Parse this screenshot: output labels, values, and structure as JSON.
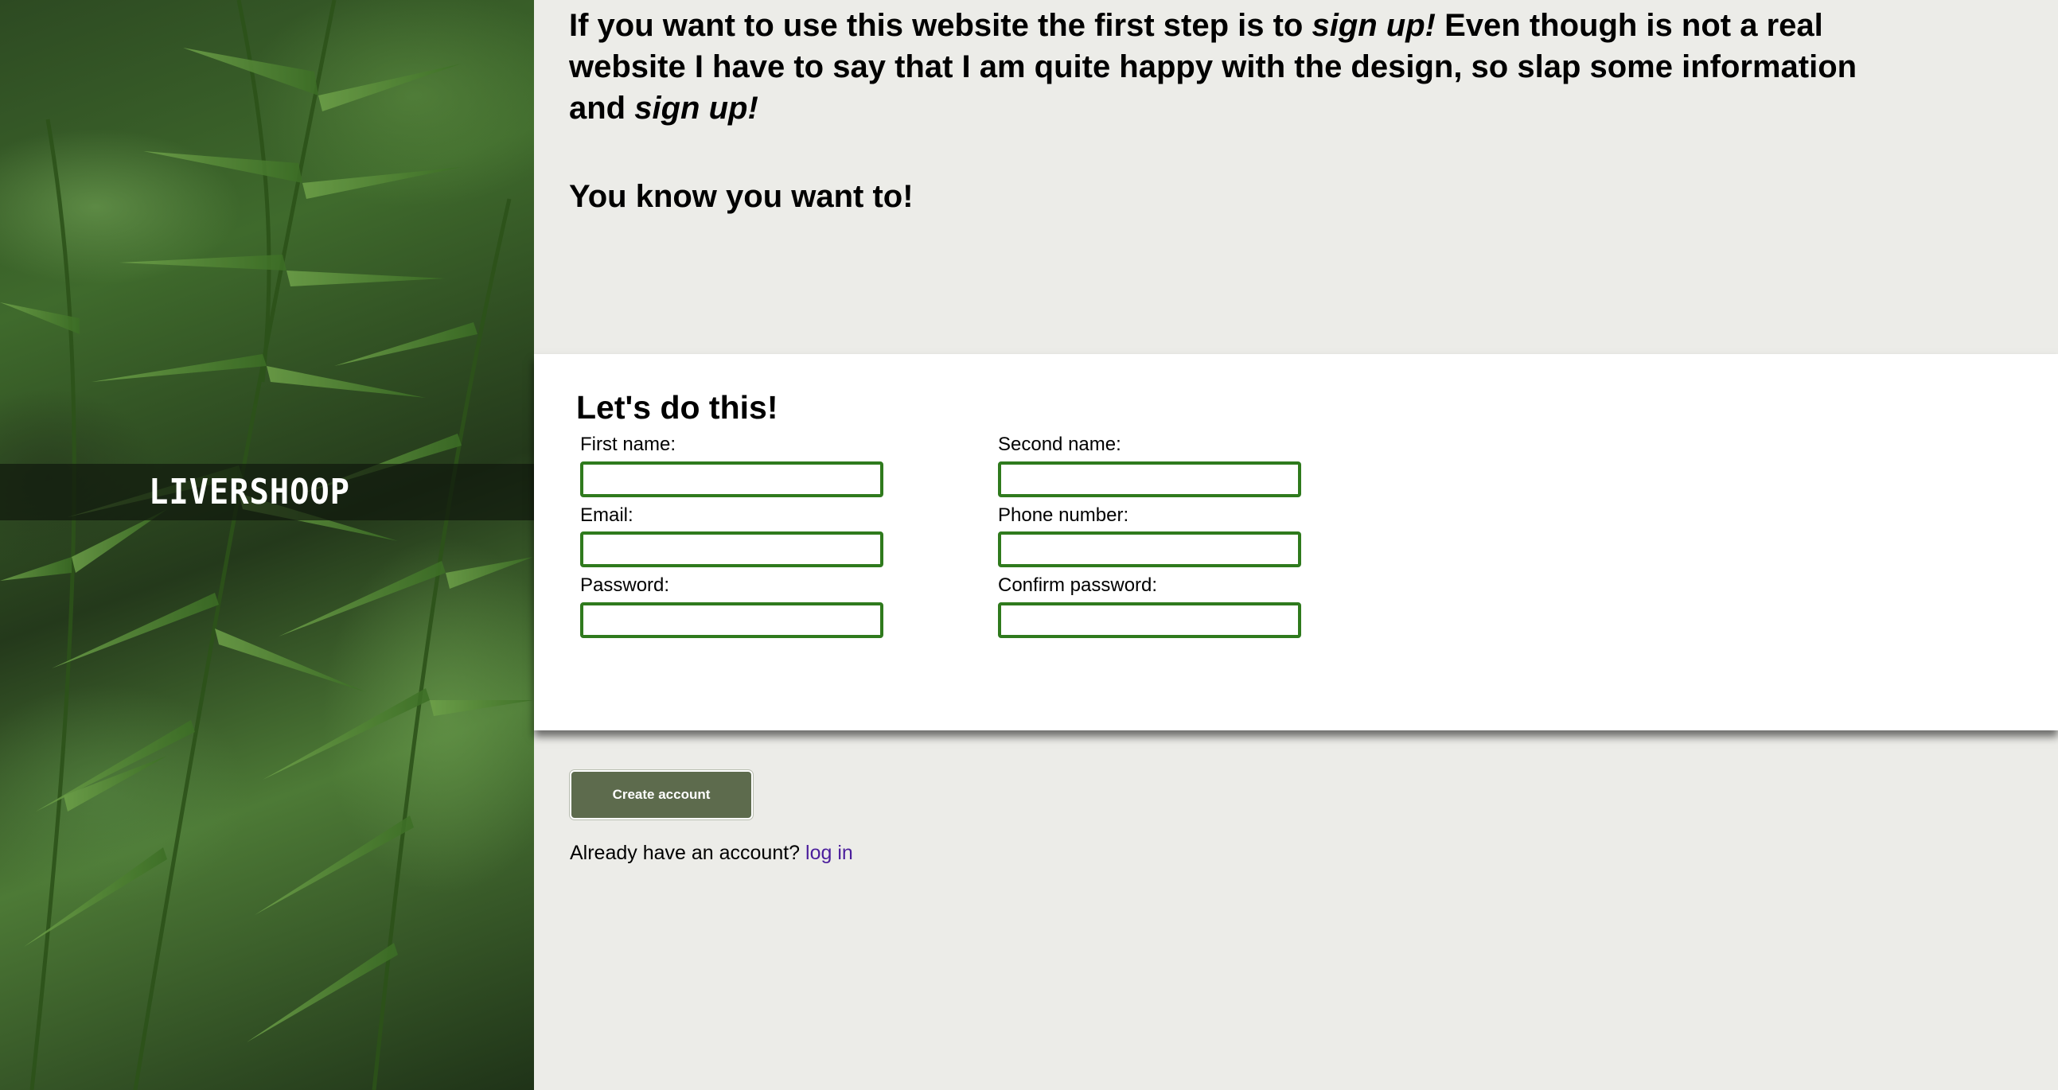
{
  "brand": {
    "name": "LIVERSHOOP"
  },
  "intro": {
    "part1": "If you want to use this website the first step is to ",
    "em1": "sign up!",
    "part2": " Even though is not a real website I have to say that I am quite happy with the design, so slap some information and ",
    "em2": "sign up!"
  },
  "tagline": "You know you want to!",
  "form": {
    "title": "Let's do this!",
    "fields": {
      "first_name": {
        "label": "First name:",
        "value": ""
      },
      "second_name": {
        "label": "Second name:",
        "value": ""
      },
      "email": {
        "label": "Email:",
        "value": ""
      },
      "phone": {
        "label": "Phone number:",
        "value": ""
      },
      "password": {
        "label": "Password:",
        "value": ""
      },
      "confirm_password": {
        "label": "Confirm password:",
        "value": ""
      }
    }
  },
  "actions": {
    "create_account": "Create account",
    "login_prompt": "Already have an account? ",
    "login_link": "log in"
  },
  "colors": {
    "page_bg": "#ecece8",
    "input_border": "#2f7a1d",
    "button_bg": "#5d6b4d",
    "link": "#4b1e9c"
  }
}
